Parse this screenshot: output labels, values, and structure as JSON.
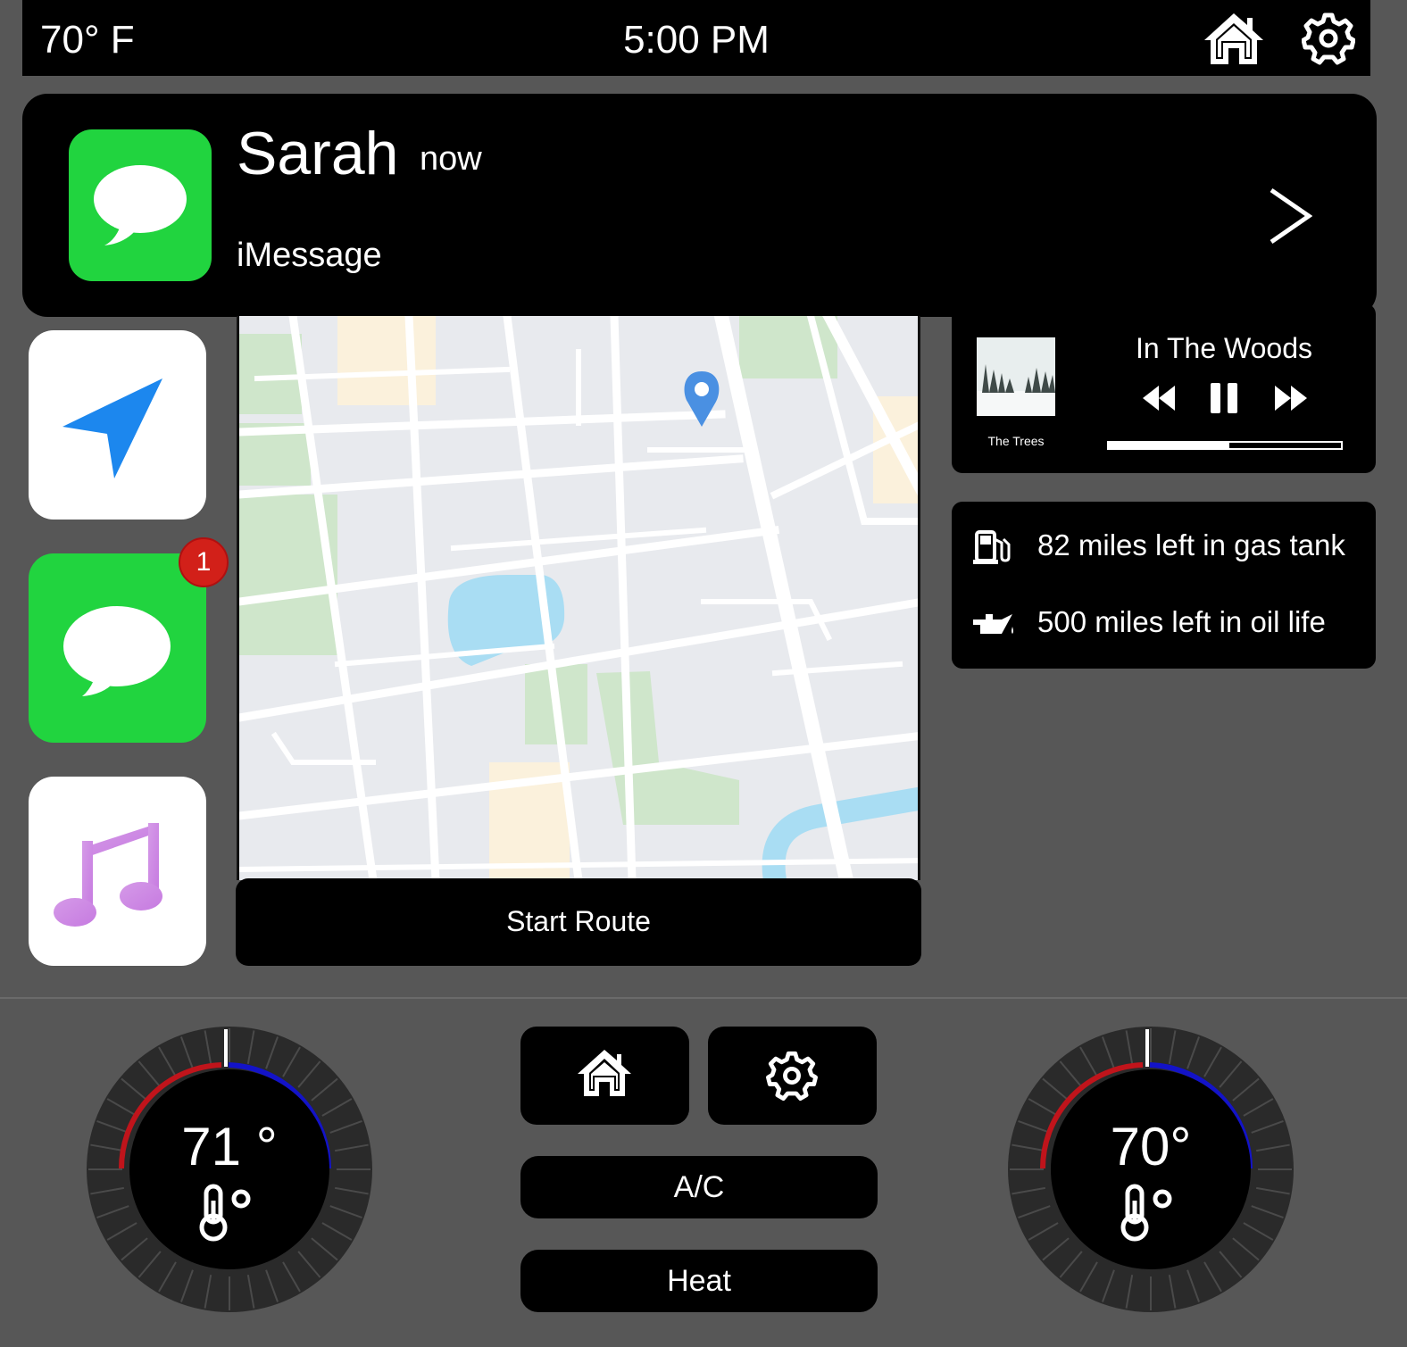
{
  "status_bar": {
    "temperature": "70° F",
    "time": "5:00 PM",
    "home_icon": "home-icon",
    "settings_icon": "gear-icon"
  },
  "notification": {
    "sender": "Sarah",
    "time": "now",
    "app": "iMessage",
    "arrow": ">"
  },
  "dock": {
    "messages_badge": "1"
  },
  "map": {
    "start_route_label": "Start Route"
  },
  "now_playing": {
    "song": "In The Woods",
    "album": "The Trees",
    "progress": 0.52
  },
  "vehicle_status": {
    "gas": "82 miles left in gas tank",
    "oil": "500 miles left in oil life"
  },
  "climate": {
    "left_temp": "71 °",
    "right_temp": "70°",
    "ac_label": "A/C",
    "heat_label": "Heat",
    "colors": {
      "heat": "#c0141b",
      "cool": "#1313c8"
    }
  }
}
